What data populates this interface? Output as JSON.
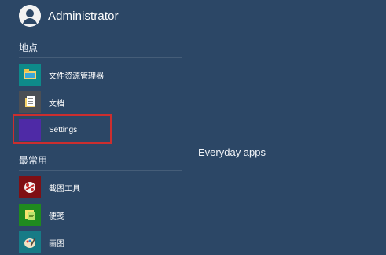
{
  "user": {
    "name": "Administrator",
    "avatar_icon": "user-avatar-icon"
  },
  "sections": {
    "places": {
      "title": "地点",
      "items": [
        {
          "label": "文件资源管理器",
          "icon": "file-explorer-icon",
          "color": "#0e8a8a"
        },
        {
          "label": "文档",
          "icon": "documents-icon",
          "color": "#4b4f55"
        },
        {
          "label": "Settings",
          "icon": "settings-icon",
          "color": "#4e2aa6"
        }
      ]
    },
    "most_used": {
      "title": "最常用",
      "items": [
        {
          "label": "截图工具",
          "icon": "snipping-tool-icon",
          "color": "#7f0f14"
        },
        {
          "label": "便笺",
          "icon": "sticky-notes-icon",
          "color": "#1f8a1f"
        },
        {
          "label": "画图",
          "icon": "paint-icon",
          "color": "#177b86"
        }
      ]
    }
  },
  "group_title": "Everyday apps",
  "colors": {
    "background": "#2c4766",
    "highlight_border": "#cc2e2e"
  }
}
